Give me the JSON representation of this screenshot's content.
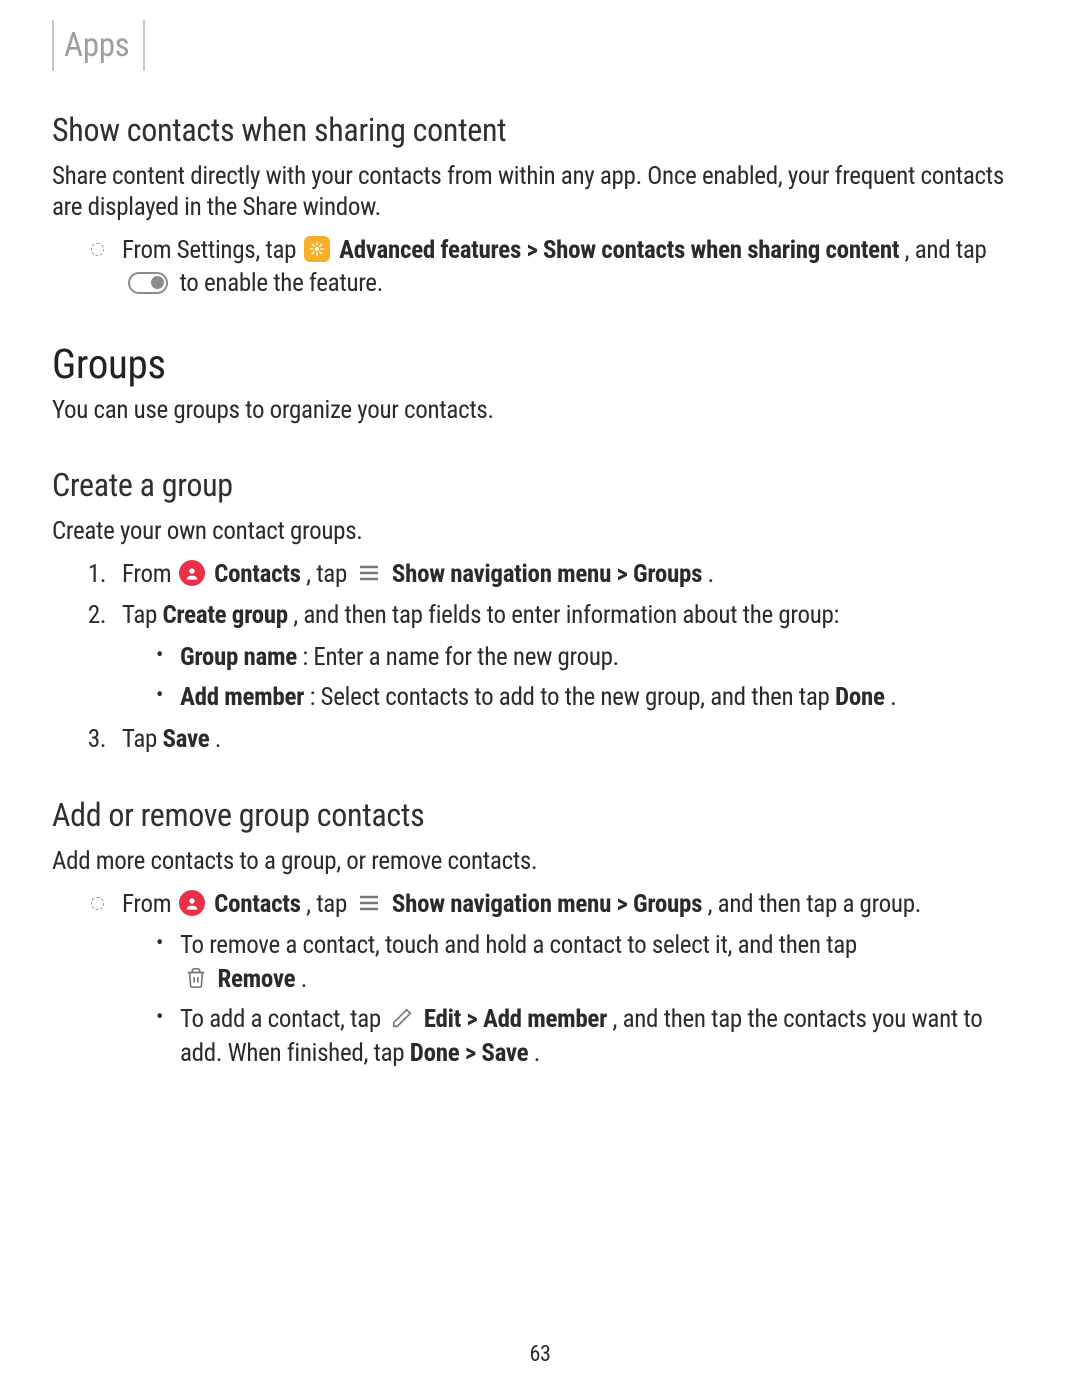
{
  "section_tab": "Apps",
  "page_number": "63",
  "s1": {
    "heading": "Show contacts when sharing content",
    "intro": "Share content directly with your contacts from within any app. Once enabled, your frequent contacts are displayed in the Share window.",
    "step_pre": "From Settings, tap ",
    "adv": "Advanced features",
    "gt": " > ",
    "path_tail": "Show contacts when sharing content",
    "comma": ", and tap ",
    "tail": " to enable the feature."
  },
  "s2": {
    "heading": "Groups",
    "intro": "You can use groups to organize your contacts."
  },
  "s3": {
    "heading": "Create a group",
    "intro": "Create your own contact groups.",
    "st1_pre": "From ",
    "contacts": "Contacts",
    "tap": ", tap ",
    "nav": "Show navigation menu",
    "gt": " > ",
    "groups": "Groups",
    "period": ".",
    "st2_pre": "Tap ",
    "create": "Create group",
    "st2_tail": ", and then tap fields to enter information about the group:",
    "b1_label": "Group name",
    "b1_text": ": Enter a name for the new group.",
    "b2_label": "Add member",
    "b2_text": ": Select contacts to add to the new group, and then tap ",
    "done": "Done",
    "st3_pre": "Tap ",
    "save": "Save"
  },
  "s4": {
    "heading": "Add or remove group contacts",
    "intro": "Add more contacts to a group, or remove contacts.",
    "st_pre": "From ",
    "contacts": "Contacts",
    "tap": ", tap ",
    "nav": "Show navigation menu",
    "gt": " > ",
    "groups": "Groups",
    "tail": ", and then tap a group.",
    "b1_pre": "To remove a contact, touch and hold a contact to select it, and then tap ",
    "remove": "Remove",
    "period": ".",
    "b2_pre": "To add a contact, tap ",
    "edit": "Edit",
    "addm": "Add member",
    "b2_mid": ", and then tap the contacts you want to add. When finished, tap ",
    "done": "Done",
    "save": "Save"
  }
}
